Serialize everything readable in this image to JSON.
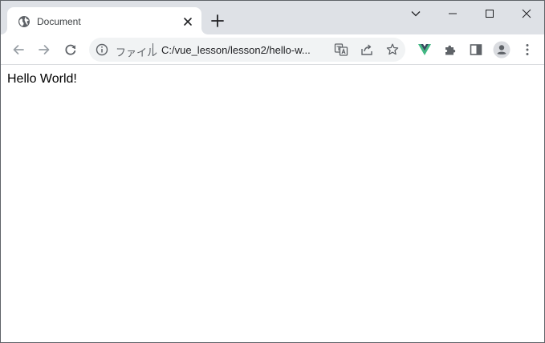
{
  "tab": {
    "title": "Document",
    "favicon_icon": "globe-icon"
  },
  "toolbar": {
    "address_label": "ファイル",
    "address_url": "C:/vue_lesson/lesson2/hello-w..."
  },
  "page": {
    "text": "Hello World!"
  },
  "colors": {
    "tabstrip_bg": "#dee1e6",
    "omnibox_bg": "#f1f3f4",
    "icon_gray": "#5f6368",
    "vue_green": "#42b883",
    "vue_dark": "#35495e"
  }
}
